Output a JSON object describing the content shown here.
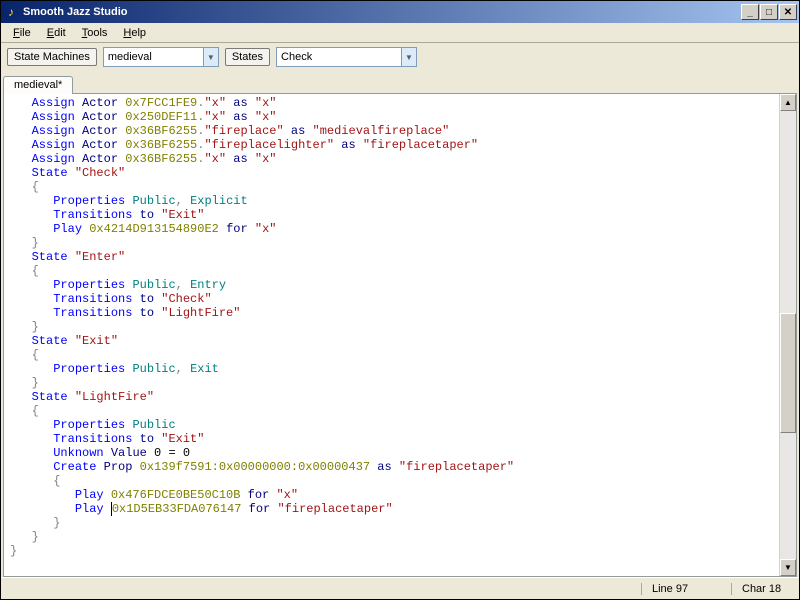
{
  "window": {
    "title": "Smooth Jazz Studio"
  },
  "menu": {
    "file": "File",
    "edit": "Edit",
    "tools": "Tools",
    "help": "Help"
  },
  "toolbar": {
    "state_machines_label": "State Machines",
    "state_machines_value": "medieval",
    "states_label": "States",
    "states_value": "Check"
  },
  "tabs": {
    "active": "medieval*"
  },
  "status": {
    "line": "Line 97",
    "char": "Char 18"
  },
  "code": {
    "lines": [
      [
        [
          "kw1",
          "Assign"
        ],
        [
          "sp",
          " "
        ],
        [
          "kw2",
          "Actor"
        ],
        [
          "sp",
          " "
        ],
        [
          "hex",
          "0x7FCC1FE9"
        ],
        [
          "punct",
          "."
        ],
        [
          "str",
          "\"x\""
        ],
        [
          "sp",
          " "
        ],
        [
          "kw2",
          "as"
        ],
        [
          "sp",
          " "
        ],
        [
          "str",
          "\"x\""
        ]
      ],
      [
        [
          "kw1",
          "Assign"
        ],
        [
          "sp",
          " "
        ],
        [
          "kw2",
          "Actor"
        ],
        [
          "sp",
          " "
        ],
        [
          "hex",
          "0x250DEF11"
        ],
        [
          "punct",
          "."
        ],
        [
          "str",
          "\"x\""
        ],
        [
          "sp",
          " "
        ],
        [
          "kw2",
          "as"
        ],
        [
          "sp",
          " "
        ],
        [
          "str",
          "\"x\""
        ]
      ],
      [
        [
          "kw1",
          "Assign"
        ],
        [
          "sp",
          " "
        ],
        [
          "kw2",
          "Actor"
        ],
        [
          "sp",
          " "
        ],
        [
          "hex",
          "0x36BF6255"
        ],
        [
          "punct",
          "."
        ],
        [
          "str",
          "\"fireplace\""
        ],
        [
          "sp",
          " "
        ],
        [
          "kw2",
          "as"
        ],
        [
          "sp",
          " "
        ],
        [
          "str",
          "\"medievalfireplace\""
        ]
      ],
      [
        [
          "kw1",
          "Assign"
        ],
        [
          "sp",
          " "
        ],
        [
          "kw2",
          "Actor"
        ],
        [
          "sp",
          " "
        ],
        [
          "hex",
          "0x36BF6255"
        ],
        [
          "punct",
          "."
        ],
        [
          "str",
          "\"fireplacelighter\""
        ],
        [
          "sp",
          " "
        ],
        [
          "kw2",
          "as"
        ],
        [
          "sp",
          " "
        ],
        [
          "str",
          "\"fireplacetaper\""
        ]
      ],
      [
        [
          "kw1",
          "Assign"
        ],
        [
          "sp",
          " "
        ],
        [
          "kw2",
          "Actor"
        ],
        [
          "sp",
          " "
        ],
        [
          "hex",
          "0x36BF6255"
        ],
        [
          "punct",
          "."
        ],
        [
          "str",
          "\"x\""
        ],
        [
          "sp",
          " "
        ],
        [
          "kw2",
          "as"
        ],
        [
          "sp",
          " "
        ],
        [
          "str",
          "\"x\""
        ]
      ],
      [
        [
          "kw1",
          "State"
        ],
        [
          "sp",
          " "
        ],
        [
          "str",
          "\"Check\""
        ]
      ],
      [
        [
          "punct",
          "{"
        ]
      ],
      [
        [
          "indent",
          1
        ],
        [
          "kw1",
          "Properties"
        ],
        [
          "sp",
          " "
        ],
        [
          "mod",
          "Public"
        ],
        [
          "punct",
          ","
        ],
        [
          "sp",
          " "
        ],
        [
          "mod",
          "Explicit"
        ]
      ],
      [
        [
          "indent",
          1
        ],
        [
          "kw1",
          "Transitions"
        ],
        [
          "sp",
          " "
        ],
        [
          "kw2",
          "to"
        ],
        [
          "sp",
          " "
        ],
        [
          "str",
          "\"Exit\""
        ]
      ],
      [
        [
          "indent",
          1
        ],
        [
          "kw1",
          "Play"
        ],
        [
          "sp",
          " "
        ],
        [
          "hex",
          "0x4214D913154890E2"
        ],
        [
          "sp",
          " "
        ],
        [
          "kw2",
          "for"
        ],
        [
          "sp",
          " "
        ],
        [
          "str",
          "\"x\""
        ]
      ],
      [
        [
          "punct",
          "}"
        ]
      ],
      [
        [
          "kw1",
          "State"
        ],
        [
          "sp",
          " "
        ],
        [
          "str",
          "\"Enter\""
        ]
      ],
      [
        [
          "punct",
          "{"
        ]
      ],
      [
        [
          "indent",
          1
        ],
        [
          "kw1",
          "Properties"
        ],
        [
          "sp",
          " "
        ],
        [
          "mod",
          "Public"
        ],
        [
          "punct",
          ","
        ],
        [
          "sp",
          " "
        ],
        [
          "mod",
          "Entry"
        ]
      ],
      [
        [
          "indent",
          1
        ],
        [
          "kw1",
          "Transitions"
        ],
        [
          "sp",
          " "
        ],
        [
          "kw2",
          "to"
        ],
        [
          "sp",
          " "
        ],
        [
          "str",
          "\"Check\""
        ]
      ],
      [
        [
          "indent",
          1
        ],
        [
          "kw1",
          "Transitions"
        ],
        [
          "sp",
          " "
        ],
        [
          "kw2",
          "to"
        ],
        [
          "sp",
          " "
        ],
        [
          "str",
          "\"LightFire\""
        ]
      ],
      [
        [
          "punct",
          "}"
        ]
      ],
      [
        [
          "kw1",
          "State"
        ],
        [
          "sp",
          " "
        ],
        [
          "str",
          "\"Exit\""
        ]
      ],
      [
        [
          "punct",
          "{"
        ]
      ],
      [
        [
          "indent",
          1
        ],
        [
          "kw1",
          "Properties"
        ],
        [
          "sp",
          " "
        ],
        [
          "mod",
          "Public"
        ],
        [
          "punct",
          ","
        ],
        [
          "sp",
          " "
        ],
        [
          "mod",
          "Exit"
        ]
      ],
      [
        [
          "punct",
          "}"
        ]
      ],
      [
        [
          "kw1",
          "State"
        ],
        [
          "sp",
          " "
        ],
        [
          "str",
          "\"LightFire\""
        ]
      ],
      [
        [
          "punct",
          "{"
        ]
      ],
      [
        [
          "indent",
          1
        ],
        [
          "kw1",
          "Properties"
        ],
        [
          "sp",
          " "
        ],
        [
          "mod",
          "Public"
        ]
      ],
      [
        [
          "indent",
          1
        ],
        [
          "kw1",
          "Transitions"
        ],
        [
          "sp",
          " "
        ],
        [
          "kw2",
          "to"
        ],
        [
          "sp",
          " "
        ],
        [
          "str",
          "\"Exit\""
        ]
      ],
      [
        [
          "indent",
          1
        ],
        [
          "kw1",
          "Unknown"
        ],
        [
          "sp",
          " "
        ],
        [
          "kw2",
          "Value"
        ],
        [
          "sp",
          " "
        ],
        [
          "txt",
          "0 = 0"
        ]
      ],
      [
        [
          "indent",
          1
        ],
        [
          "kw1",
          "Create"
        ],
        [
          "sp",
          " "
        ],
        [
          "kw2",
          "Prop"
        ],
        [
          "sp",
          " "
        ],
        [
          "hex",
          "0x139f7591:0x00000000:0x00000437"
        ],
        [
          "sp",
          " "
        ],
        [
          "kw2",
          "as"
        ],
        [
          "sp",
          " "
        ],
        [
          "str",
          "\"fireplacetaper\""
        ]
      ],
      [
        [
          "indent",
          1
        ],
        [
          "punct",
          "{"
        ]
      ],
      [
        [
          "indent",
          2
        ],
        [
          "kw1",
          "Play"
        ],
        [
          "sp",
          " "
        ],
        [
          "hex",
          "0x476FDCE0BE50C10B"
        ],
        [
          "sp",
          " "
        ],
        [
          "kw2",
          "for"
        ],
        [
          "sp",
          " "
        ],
        [
          "str",
          "\"x\""
        ]
      ],
      [
        [
          "indent",
          2
        ],
        [
          "kw1",
          "Play"
        ],
        [
          "sp",
          " "
        ],
        [
          "caret",
          ""
        ],
        [
          "hex",
          "0x1D5EB33FDA076147"
        ],
        [
          "sp",
          " "
        ],
        [
          "kw2",
          "for"
        ],
        [
          "sp",
          " "
        ],
        [
          "str",
          "\"fireplacetaper\""
        ]
      ],
      [
        [
          "indent",
          1
        ],
        [
          "punct",
          "}"
        ]
      ],
      [
        [
          "punct",
          "}"
        ]
      ]
    ],
    "base_indent": "   ",
    "closing_brace": "}"
  }
}
